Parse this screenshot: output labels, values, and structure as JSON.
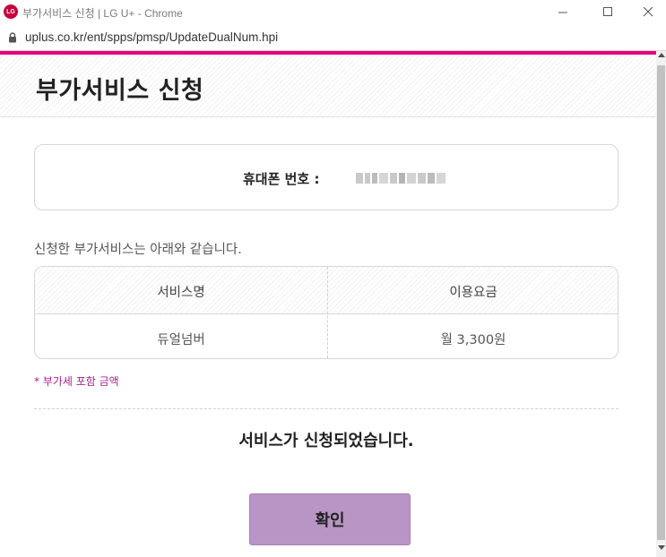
{
  "window": {
    "title": "부가서비스 신청 | LG U+ - Chrome",
    "logo_text": "LG",
    "controls": [
      "minimize-icon",
      "maximize-icon",
      "close-icon"
    ]
  },
  "address_bar": {
    "url": "uplus.co.kr/ent/spps/pmsp/UpdateDualNum.hpi",
    "icon": "lock-icon"
  },
  "colors": {
    "accent": "#e6007e",
    "button_bg": "#b895c4",
    "note_text": "#a3238e"
  },
  "page": {
    "title": "부가서비스 신청",
    "phone_label": "휴대폰 번호 :",
    "intro_text": "신청한 부가서비스는 아래와 같습니다.",
    "table": {
      "headers": [
        "서비스명",
        "이용요금"
      ],
      "rows": [
        [
          "듀얼넘버",
          "월 3,300원"
        ]
      ]
    },
    "vat_note": "* 부가세 포함 금액",
    "completion_message": "서비스가 신청되었습니다.",
    "confirm_label": "확인"
  }
}
